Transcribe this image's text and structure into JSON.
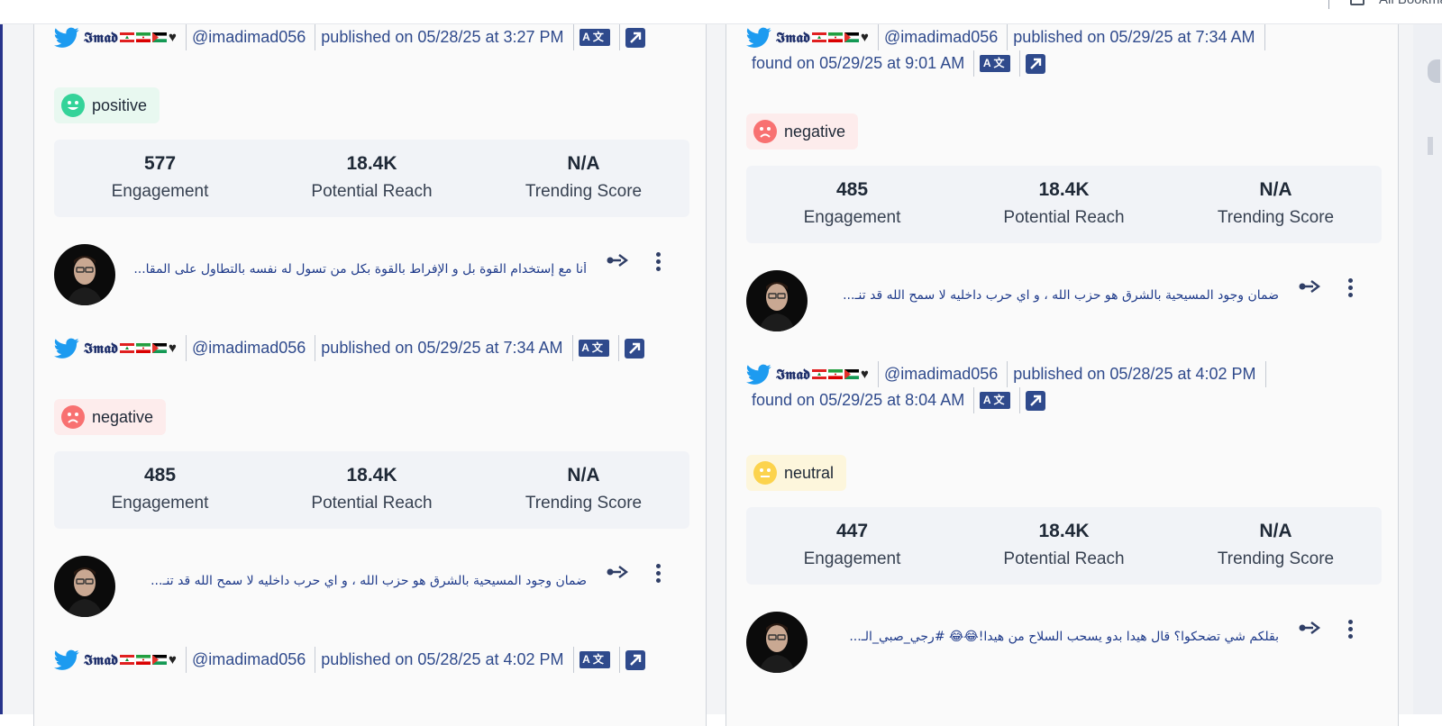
{
  "browser": {
    "bookmarks_label": "All Bookmarks"
  },
  "colors": {
    "accent": "#2f4a8c",
    "text_blue": "#1e3a8a",
    "positive": "#34d399",
    "negative": "#f87171",
    "neutral": "#fcd34d"
  },
  "left_column": [
    {
      "meta": {
        "author": "𝕴𝖒𝖆𝖉",
        "handle": "@imadimad056",
        "published": "published on 05/28/25 at 3:27 PM",
        "found": ""
      },
      "sentiment": "positive",
      "stats": [
        {
          "value": "577",
          "label": "Engagement"
        },
        {
          "value": "18.4K",
          "label": "Potential Reach"
        },
        {
          "value": "N/A",
          "label": "Trending Score"
        }
      ],
      "text": "أنا مع إستخدام القوة بل و الإفراط بالقوة بكل من تسول له نفسه بالتطاول على المقا..."
    },
    {
      "meta": {
        "author": "𝕴𝖒𝖆𝖉",
        "handle": "@imadimad056",
        "published": "published on 05/29/25 at 7:34 AM",
        "found": ""
      },
      "sentiment": "negative",
      "stats": [
        {
          "value": "485",
          "label": "Engagement"
        },
        {
          "value": "18.4K",
          "label": "Potential Reach"
        },
        {
          "value": "N/A",
          "label": "Trending Score"
        }
      ],
      "text": "ضمان وجود المسيحية بالشرق هو حزب الله ، و اي حرب داخليه لا سمح الله قد تنـ..."
    },
    {
      "meta": {
        "author": "𝕴𝖒𝖆𝖉",
        "handle": "@imadimad056",
        "published": "published on 05/28/25 at 4:02 PM",
        "found": ""
      }
    }
  ],
  "right_column": [
    {
      "meta": {
        "author": "𝕴𝖒𝖆𝖉",
        "handle": "@imadimad056",
        "published": "published on 05/29/25 at 7:34 AM",
        "found": "found on 05/29/25 at 9:01 AM"
      },
      "sentiment": "negative",
      "stats": [
        {
          "value": "485",
          "label": "Engagement"
        },
        {
          "value": "18.4K",
          "label": "Potential Reach"
        },
        {
          "value": "N/A",
          "label": "Trending Score"
        }
      ],
      "text": "ضمان وجود المسيحية بالشرق هو حزب الله ، و اي حرب داخليه لا سمح الله قد تنـ..."
    },
    {
      "meta": {
        "author": "𝕴𝖒𝖆𝖉",
        "handle": "@imadimad056",
        "published": "published on 05/28/25 at 4:02 PM",
        "found": "found on 05/29/25 at 8:04 AM"
      },
      "sentiment": "neutral",
      "stats": [
        {
          "value": "447",
          "label": "Engagement"
        },
        {
          "value": "18.4K",
          "label": "Potential Reach"
        },
        {
          "value": "N/A",
          "label": "Trending Score"
        }
      ],
      "text": "بقلكم شي تضحكوا؟ قال هيدا بدو يسحب السلاح من هيدا!😂😂 #رجي_صبي_الـ..."
    }
  ]
}
